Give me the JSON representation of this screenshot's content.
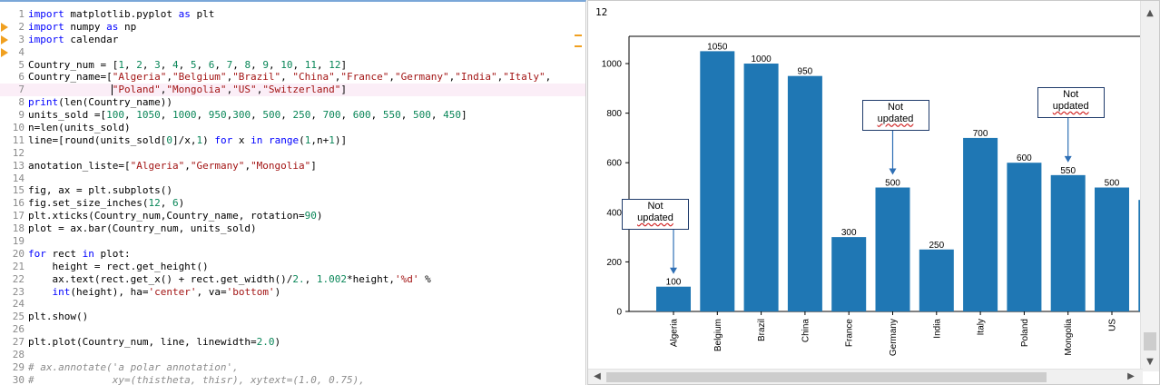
{
  "editor": {
    "lines": [
      {
        "n": "1",
        "tokens": [
          [
            "kw",
            "import"
          ],
          [
            "t",
            " matplotlib.pyplot "
          ],
          [
            "kw",
            "as"
          ],
          [
            "t",
            " plt"
          ]
        ]
      },
      {
        "n": "2",
        "tokens": [
          [
            "kw",
            "import"
          ],
          [
            "t",
            " numpy "
          ],
          [
            "kw",
            "as"
          ],
          [
            "t",
            " np"
          ]
        ]
      },
      {
        "n": "3",
        "tokens": [
          [
            "kw",
            "import"
          ],
          [
            "t",
            " calendar"
          ]
        ]
      },
      {
        "n": "4",
        "tokens": []
      },
      {
        "n": "5",
        "tokens": [
          [
            "t",
            "Country_num = ["
          ],
          [
            "num",
            "1"
          ],
          [
            "t",
            ", "
          ],
          [
            "num",
            "2"
          ],
          [
            "t",
            ", "
          ],
          [
            "num",
            "3"
          ],
          [
            "t",
            ", "
          ],
          [
            "num",
            "4"
          ],
          [
            "t",
            ", "
          ],
          [
            "num",
            "5"
          ],
          [
            "t",
            ", "
          ],
          [
            "num",
            "6"
          ],
          [
            "t",
            ", "
          ],
          [
            "num",
            "7"
          ],
          [
            "t",
            ", "
          ],
          [
            "num",
            "8"
          ],
          [
            "t",
            ", "
          ],
          [
            "num",
            "9"
          ],
          [
            "t",
            ", "
          ],
          [
            "num",
            "10"
          ],
          [
            "t",
            ", "
          ],
          [
            "num",
            "11"
          ],
          [
            "t",
            ", "
          ],
          [
            "num",
            "12"
          ],
          [
            "t",
            "]"
          ]
        ]
      },
      {
        "n": "6",
        "tokens": [
          [
            "t",
            "Country_name=["
          ],
          [
            "str",
            "\"Algeria\""
          ],
          [
            "t",
            ","
          ],
          [
            "str",
            "\"Belgium\""
          ],
          [
            "t",
            ","
          ],
          [
            "str",
            "\"Brazil\""
          ],
          [
            "t",
            ", "
          ],
          [
            "str",
            "\"China\""
          ],
          [
            "t",
            ","
          ],
          [
            "str",
            "\"France\""
          ],
          [
            "t",
            ","
          ],
          [
            "str",
            "\"Germany\""
          ],
          [
            "t",
            ","
          ],
          [
            "str",
            "\"India\""
          ],
          [
            "t",
            ","
          ],
          [
            "str",
            "\"Italy\""
          ],
          [
            "t",
            ","
          ]
        ]
      },
      {
        "n": "7",
        "tokens": [
          [
            "t",
            "              "
          ],
          [
            "str",
            "\"Poland\""
          ],
          [
            "t",
            ","
          ],
          [
            "str",
            "\"Mongolia\""
          ],
          [
            "t",
            ","
          ],
          [
            "str",
            "\"US\""
          ],
          [
            "t",
            ","
          ],
          [
            "str",
            "\"Switzerland\""
          ],
          [
            "t",
            "]"
          ]
        ],
        "highlight": true
      },
      {
        "n": "8",
        "tokens": [
          [
            "kw",
            "print"
          ],
          [
            "t",
            "(len(Country_name))"
          ]
        ]
      },
      {
        "n": "9",
        "tokens": [
          [
            "t",
            "units_sold =["
          ],
          [
            "num",
            "100"
          ],
          [
            "t",
            ", "
          ],
          [
            "num",
            "1050"
          ],
          [
            "t",
            ", "
          ],
          [
            "num",
            "1000"
          ],
          [
            "t",
            ", "
          ],
          [
            "num",
            "950"
          ],
          [
            "t",
            ","
          ],
          [
            "num",
            "300"
          ],
          [
            "t",
            ", "
          ],
          [
            "num",
            "500"
          ],
          [
            "t",
            ", "
          ],
          [
            "num",
            "250"
          ],
          [
            "t",
            ", "
          ],
          [
            "num",
            "700"
          ],
          [
            "t",
            ", "
          ],
          [
            "num",
            "600"
          ],
          [
            "t",
            ", "
          ],
          [
            "num",
            "550"
          ],
          [
            "t",
            ", "
          ],
          [
            "num",
            "500"
          ],
          [
            "t",
            ", "
          ],
          [
            "num",
            "450"
          ],
          [
            "t",
            "]"
          ]
        ]
      },
      {
        "n": "10",
        "tokens": [
          [
            "t",
            "n=len(units_sold)"
          ]
        ]
      },
      {
        "n": "11",
        "tokens": [
          [
            "t",
            "line=[round(units_sold["
          ],
          [
            "num",
            "0"
          ],
          [
            "t",
            "]/x,"
          ],
          [
            "num",
            "1"
          ],
          [
            "t",
            ") "
          ],
          [
            "kw",
            "for"
          ],
          [
            "t",
            " x "
          ],
          [
            "kw",
            "in"
          ],
          [
            "t",
            " "
          ],
          [
            "kw",
            "range"
          ],
          [
            "t",
            "("
          ],
          [
            "num",
            "1"
          ],
          [
            "t",
            ",n+"
          ],
          [
            "num",
            "1"
          ],
          [
            "t",
            ")]"
          ]
        ]
      },
      {
        "n": "12",
        "tokens": []
      },
      {
        "n": "13",
        "tokens": [
          [
            "t",
            "anotation_liste=["
          ],
          [
            "str",
            "\"Algeria\""
          ],
          [
            "t",
            ","
          ],
          [
            "str",
            "\"Germany\""
          ],
          [
            "t",
            ","
          ],
          [
            "str",
            "\"Mongolia\""
          ],
          [
            "t",
            "]"
          ]
        ]
      },
      {
        "n": "14",
        "tokens": []
      },
      {
        "n": "15",
        "tokens": [
          [
            "t",
            "fig, ax = plt.subplots()"
          ]
        ]
      },
      {
        "n": "16",
        "tokens": [
          [
            "t",
            "fig.set_size_inches("
          ],
          [
            "num",
            "12"
          ],
          [
            "t",
            ", "
          ],
          [
            "num",
            "6"
          ],
          [
            "t",
            ")"
          ]
        ]
      },
      {
        "n": "17",
        "tokens": [
          [
            "t",
            "plt.xticks(Country_num,Country_name, rotation="
          ],
          [
            "num",
            "90"
          ],
          [
            "t",
            ")"
          ]
        ]
      },
      {
        "n": "18",
        "tokens": [
          [
            "t",
            "plot = ax.bar(Country_num, units_sold)"
          ]
        ]
      },
      {
        "n": "19",
        "tokens": []
      },
      {
        "n": "20",
        "tokens": [
          [
            "kw",
            "for"
          ],
          [
            "t",
            " rect "
          ],
          [
            "kw",
            "in"
          ],
          [
            "t",
            " plot:"
          ]
        ]
      },
      {
        "n": "21",
        "tokens": [
          [
            "t",
            "    height = rect.get_height()"
          ]
        ]
      },
      {
        "n": "22",
        "tokens": [
          [
            "t",
            "    ax.text(rect.get_x() + rect.get_width()/"
          ],
          [
            "num",
            "2."
          ],
          [
            "t",
            ", "
          ],
          [
            "num",
            "1.002"
          ],
          [
            "t",
            "*height,"
          ],
          [
            "str",
            "'%d'"
          ],
          [
            "t",
            " %"
          ]
        ]
      },
      {
        "n": "23",
        "tokens": [
          [
            "t",
            "    "
          ],
          [
            "kw",
            "int"
          ],
          [
            "t",
            "(height), ha="
          ],
          [
            "str",
            "'center'"
          ],
          [
            "t",
            ", va="
          ],
          [
            "str",
            "'bottom'"
          ],
          [
            "t",
            ")"
          ]
        ]
      },
      {
        "n": "24",
        "tokens": []
      },
      {
        "n": "25",
        "tokens": [
          [
            "t",
            "plt.show()"
          ]
        ]
      },
      {
        "n": "26",
        "tokens": []
      },
      {
        "n": "27",
        "tokens": [
          [
            "t",
            "plt.plot(Country_num, line, linewidth="
          ],
          [
            "num",
            "2.0"
          ],
          [
            "t",
            ")"
          ]
        ]
      },
      {
        "n": "28",
        "tokens": []
      },
      {
        "n": "29",
        "tokens": [
          [
            "com",
            "# ax.annotate('a polar annotation',"
          ]
        ]
      },
      {
        "n": "30",
        "tokens": [
          [
            "com",
            "#             xy=(thistheta, thisr), xytext=(1.0, 0.75),"
          ]
        ]
      }
    ]
  },
  "output": {
    "printed_text": "12"
  },
  "scrollbar": {
    "up_icon": "▲",
    "down_icon": "▼",
    "left_icon": "◀",
    "right_icon": "▶"
  },
  "chart_data": {
    "type": "bar",
    "categories": [
      "Algeria",
      "Belgium",
      "Brazil",
      "China",
      "France",
      "Germany",
      "India",
      "Italy",
      "Poland",
      "Mongolia",
      "US"
    ],
    "values": [
      100,
      1050,
      1000,
      950,
      300,
      500,
      250,
      700,
      600,
      550,
      500
    ],
    "value_labels": [
      "100",
      "1050",
      "1000",
      "950",
      "300",
      "500",
      "250",
      "700",
      "600",
      "550",
      "500"
    ],
    "partial_next_value": 450,
    "ylim": [
      0,
      1110
    ],
    "yticks": [
      0,
      200,
      400,
      600,
      800,
      1000
    ],
    "title": "",
    "xlabel": "",
    "ylabel": "",
    "bar_color": "#1f77b4",
    "x_tick_rotation": 90,
    "grid": false,
    "annotations": [
      {
        "category": "Algeria",
        "line1": "Not",
        "line2": "updated"
      },
      {
        "category": "Germany",
        "line1": "Not",
        "line2": "updated"
      },
      {
        "category": "Mongolia",
        "line1": "Not",
        "line2": "updated"
      }
    ]
  }
}
